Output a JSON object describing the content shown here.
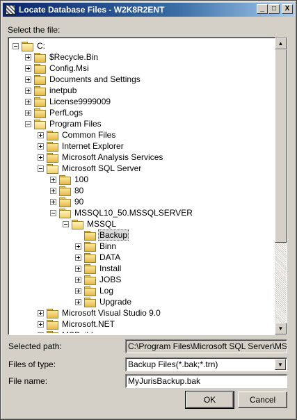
{
  "window": {
    "title": "Locate Database Files - W2K8R2ENT"
  },
  "title_buttons": {
    "minimize": "_",
    "maximize": "□",
    "close": "X"
  },
  "select_label": "Select the file:",
  "tree": [
    {
      "label": "C:",
      "level": 0,
      "expander": "minus",
      "open": true
    },
    {
      "label": "$Recycle.Bin",
      "level": 1,
      "expander": "plus"
    },
    {
      "label": "Config.Msi",
      "level": 1,
      "expander": "plus"
    },
    {
      "label": "Documents and Settings",
      "level": 1,
      "expander": "plus"
    },
    {
      "label": "inetpub",
      "level": 1,
      "expander": "plus"
    },
    {
      "label": "License9999009",
      "level": 1,
      "expander": "plus"
    },
    {
      "label": "PerfLogs",
      "level": 1,
      "expander": "plus"
    },
    {
      "label": "Program Files",
      "level": 1,
      "expander": "minus",
      "open": true
    },
    {
      "label": "Common Files",
      "level": 2,
      "expander": "plus"
    },
    {
      "label": "Internet Explorer",
      "level": 2,
      "expander": "plus"
    },
    {
      "label": "Microsoft Analysis Services",
      "level": 2,
      "expander": "plus"
    },
    {
      "label": "Microsoft SQL Server",
      "level": 2,
      "expander": "minus",
      "open": true
    },
    {
      "label": "100",
      "level": 3,
      "expander": "plus"
    },
    {
      "label": "80",
      "level": 3,
      "expander": "plus"
    },
    {
      "label": "90",
      "level": 3,
      "expander": "plus"
    },
    {
      "label": "MSSQL10_50.MSSQLSERVER",
      "level": 3,
      "expander": "minus",
      "open": true
    },
    {
      "label": "MSSQL",
      "level": 4,
      "expander": "minus",
      "open": true
    },
    {
      "label": "Backup",
      "level": 5,
      "expander": "none",
      "selected": true
    },
    {
      "label": "Binn",
      "level": 5,
      "expander": "plus"
    },
    {
      "label": "DATA",
      "level": 5,
      "expander": "plus"
    },
    {
      "label": "Install",
      "level": 5,
      "expander": "plus"
    },
    {
      "label": "JOBS",
      "level": 5,
      "expander": "plus"
    },
    {
      "label": "Log",
      "level": 5,
      "expander": "plus"
    },
    {
      "label": "Upgrade",
      "level": 5,
      "expander": "plus"
    },
    {
      "label": "Microsoft Visual Studio 9.0",
      "level": 2,
      "expander": "plus"
    },
    {
      "label": "Microsoft.NET",
      "level": 2,
      "expander": "plus"
    },
    {
      "label": "MSBuild",
      "level": 2,
      "expander": "plus"
    }
  ],
  "selected_path": {
    "label": "Selected path:",
    "value": "C:\\Program Files\\Microsoft SQL Server\\MSSQL"
  },
  "files_of_type": {
    "label": "Files of type:",
    "value": "Backup Files(*.bak;*.trn)"
  },
  "file_name": {
    "label": "File name:",
    "value": "MyJurisBackup.bak"
  },
  "buttons": {
    "ok": "OK",
    "cancel": "Cancel"
  }
}
